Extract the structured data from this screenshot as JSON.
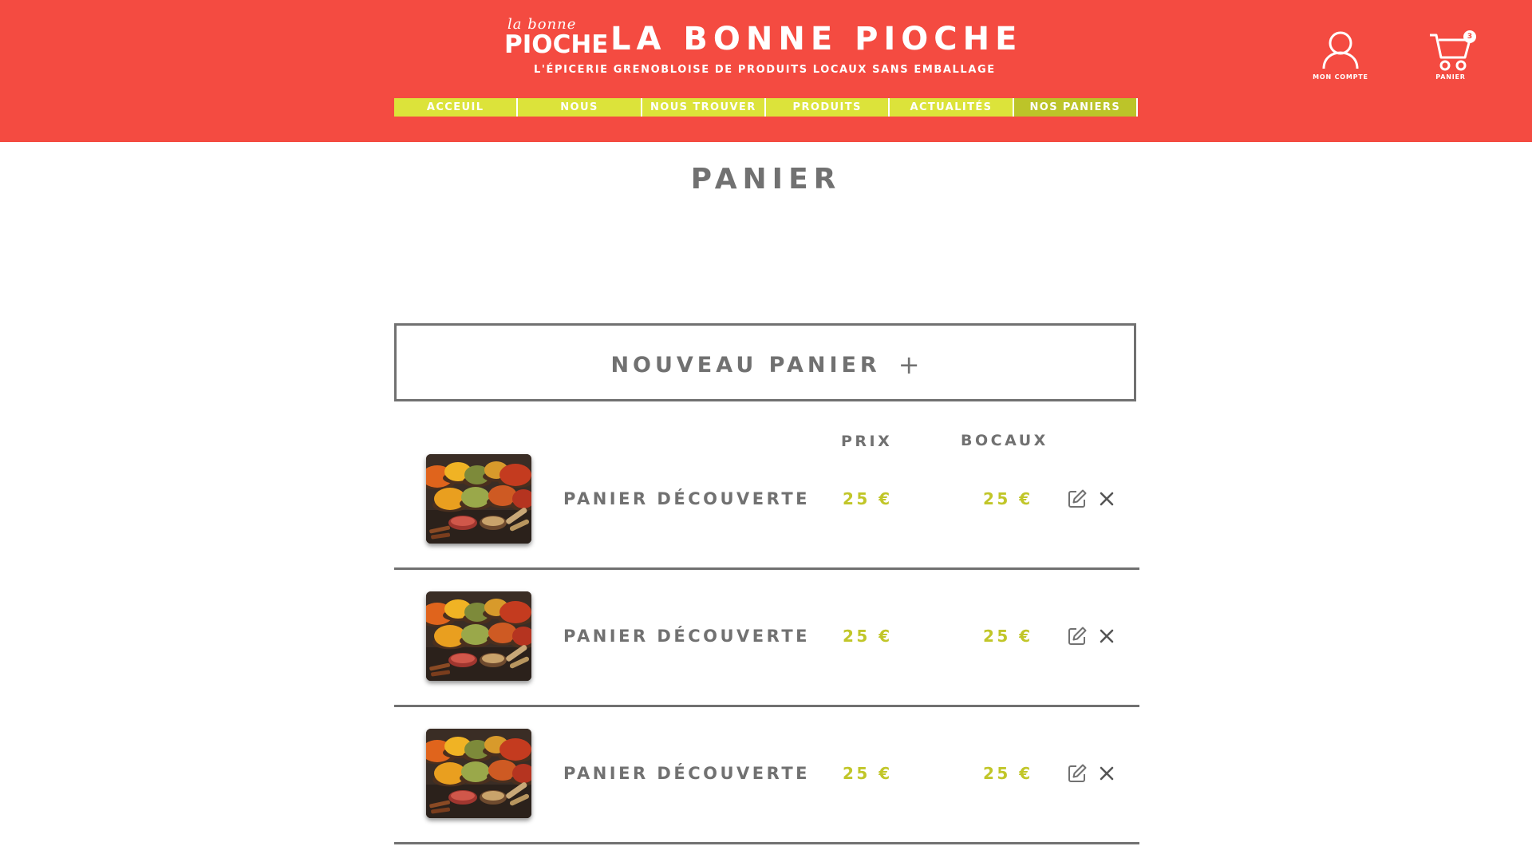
{
  "header": {
    "logo_script": "la bonne",
    "logo_mark": "PIOCHE",
    "title": "LA BONNE PIOCHE",
    "tagline": "L'ÉPICERIE GRENOBLOISE DE PRODUITS LOCAUX SANS EMBALLAGE",
    "account_label": "MON COMPTE",
    "cart_label": "PANIER",
    "cart_count": "3",
    "background_color": "#f44b41"
  },
  "nav": {
    "items": [
      {
        "label": "ACCEUIL"
      },
      {
        "label": "NOUS"
      },
      {
        "label": "NOUS TROUVER"
      },
      {
        "label": "PRODUITS"
      },
      {
        "label": "ACTUALITÉS"
      },
      {
        "label": "NOS PANIERS",
        "active": true
      }
    ],
    "color": "#dce33a",
    "active_color": "#bcc429"
  },
  "page": {
    "title": "PANIER",
    "new_basket_label": "NOUVEAU PANIER",
    "new_basket_icon": "plus-icon"
  },
  "table": {
    "columns": {
      "price": "PRIX",
      "jars": "BOCAUX"
    },
    "rows": [
      {
        "name": "PANIER DÉCOUVERTE",
        "price": "25 €",
        "jars": "25 €",
        "image": "spices-bowls-photo"
      },
      {
        "name": "PANIER DÉCOUVERTE",
        "price": "25 €",
        "jars": "25 €",
        "image": "spices-bowls-photo"
      },
      {
        "name": "PANIER DÉCOUVERTE",
        "price": "25 €",
        "jars": "25 €",
        "image": "spices-bowls-photo"
      }
    ],
    "row_actions": [
      "edit-icon",
      "close-icon"
    ],
    "price_color": "#c1c629",
    "text_color": "#717171"
  }
}
